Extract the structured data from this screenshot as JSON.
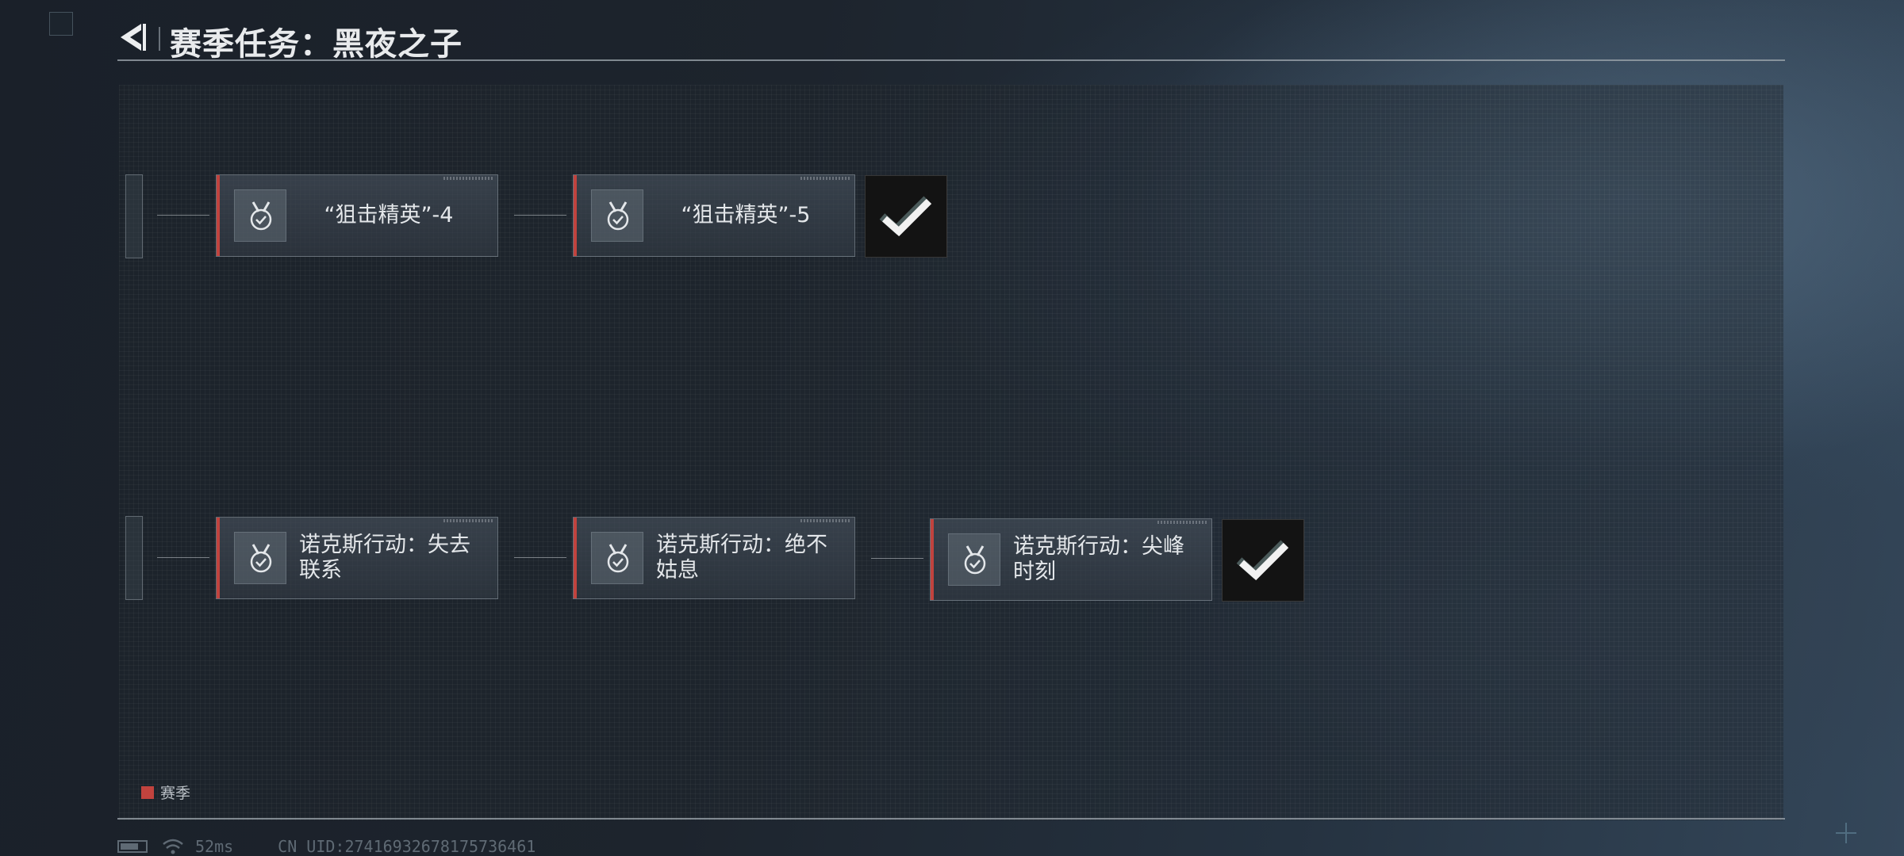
{
  "header": {
    "title": "赛季任务：黑夜之子"
  },
  "rows": [
    {
      "tasks": [
        {
          "label": "“狙击精英”-4"
        },
        {
          "label": "“狙击精英”-5"
        }
      ]
    },
    {
      "tasks": [
        {
          "label": "诺克斯行动：失去联系"
        },
        {
          "label": "诺克斯行动：绝不姑息"
        },
        {
          "label": "诺克斯行动：尖峰时刻"
        }
      ]
    }
  ],
  "legend": {
    "label": "赛季",
    "color": "#c1433e"
  },
  "status_bar": {
    "ping": "52ms",
    "uid": "CN UID:274169326781757364​61"
  },
  "icons": {
    "back": "back-arrow-icon",
    "task": "medal-check-icon",
    "complete": "checkmark-icon",
    "wifi": "wifi-icon",
    "battery": "battery-icon"
  }
}
